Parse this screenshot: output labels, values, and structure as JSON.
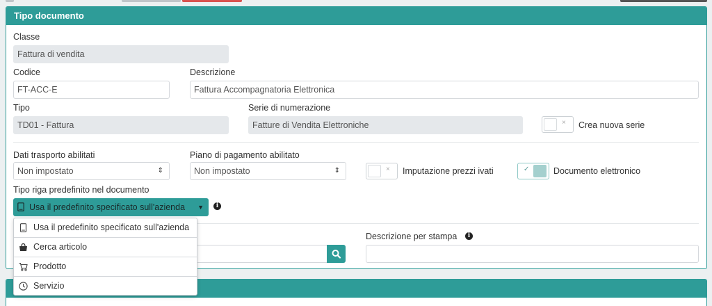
{
  "panel": {
    "title": "Tipo documento",
    "classe": {
      "label": "Classe",
      "value": "Fattura di vendita"
    },
    "codice": {
      "label": "Codice",
      "value": "FT-ACC-E"
    },
    "descrizione": {
      "label": "Descrizione",
      "value": "Fattura Accompagnatoria Elettronica"
    },
    "tipo": {
      "label": "Tipo",
      "value": "TD01 - Fattura"
    },
    "serie": {
      "label": "Serie di numerazione",
      "value": "Fatture di Vendita Elettroniche"
    },
    "crea_nuova_serie": {
      "label": "Crea nuova serie",
      "checked": false
    },
    "dati_trasporto": {
      "label": "Dati trasporto abilitati",
      "value": "Non impostato"
    },
    "piano_pagamento": {
      "label": "Piano di pagamento abilitato",
      "value": "Non impostato"
    },
    "imputazione_prezzi": {
      "label": "Imputazione prezzi ivati",
      "checked": false
    },
    "documento_elettronico": {
      "label": "Documento elettronico",
      "checked": true
    },
    "tipo_riga": {
      "label": "Tipo riga predefinito nel documento",
      "value": "Usa il predefinito specificato sull'azienda"
    },
    "descrizione_stampa": {
      "label": "Descrizione per stampa",
      "value": ""
    }
  },
  "menu": {
    "items": [
      {
        "label": "Usa il predefinito specificato sull'azienda",
        "icon": "mobile-icon"
      },
      {
        "label": "Cerca articolo",
        "icon": "shopping-bag-icon"
      },
      {
        "label": "Prodotto",
        "icon": "cart-icon"
      },
      {
        "label": "Servizio",
        "icon": "clock-icon"
      }
    ]
  },
  "icons": {
    "select_arrows": "⇕",
    "check": "✓",
    "cross": "×",
    "caret": "▼",
    "info": "i"
  },
  "colors": {
    "accent": "#2e9c98",
    "readonly_bg": "#e5e8eb",
    "toggle_on": "#a4d0ce"
  }
}
